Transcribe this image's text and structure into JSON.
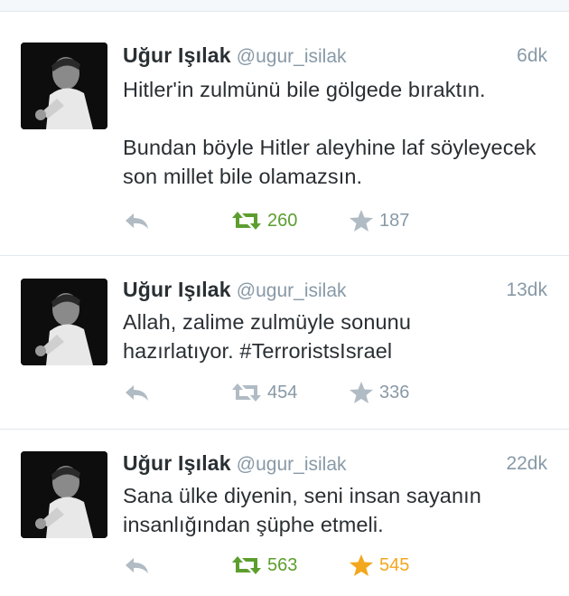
{
  "tweets": [
    {
      "name": "Uğur Işılak",
      "handle": "@ugur_isilak",
      "time": "6dk",
      "text": "Hitler'in zulmünü bile gölgede bıraktın.\n\nBundan böyle Hitler aleyhine laf söyleyecek son millet bile olamazsın.",
      "retweets": "260",
      "favorites": "187",
      "retweeted": true,
      "favorited": false
    },
    {
      "name": "Uğur Işılak",
      "handle": "@ugur_isilak",
      "time": "13dk",
      "text": "Allah, zalime zulmüyle sonunu\nhazırlatıyor.    #TerroristsIsrael",
      "retweets": "454",
      "favorites": "336",
      "retweeted": false,
      "favorited": false
    },
    {
      "name": "Uğur Işılak",
      "handle": "@ugur_isilak",
      "time": "22dk",
      "text": "Sana ülke diyenin, seni insan sayanın\ninsanlığından şüphe etmeli.",
      "retweets": "563",
      "favorites": "545",
      "retweeted": true,
      "favorited": true
    }
  ],
  "colors": {
    "retweet_active": "#5c9e2e",
    "favorite_active": "#f2a71d",
    "inactive": "#b0bbc4",
    "muted_text": "#8899a6"
  },
  "icons": [
    "reply-icon",
    "retweet-icon",
    "favorite-icon"
  ]
}
